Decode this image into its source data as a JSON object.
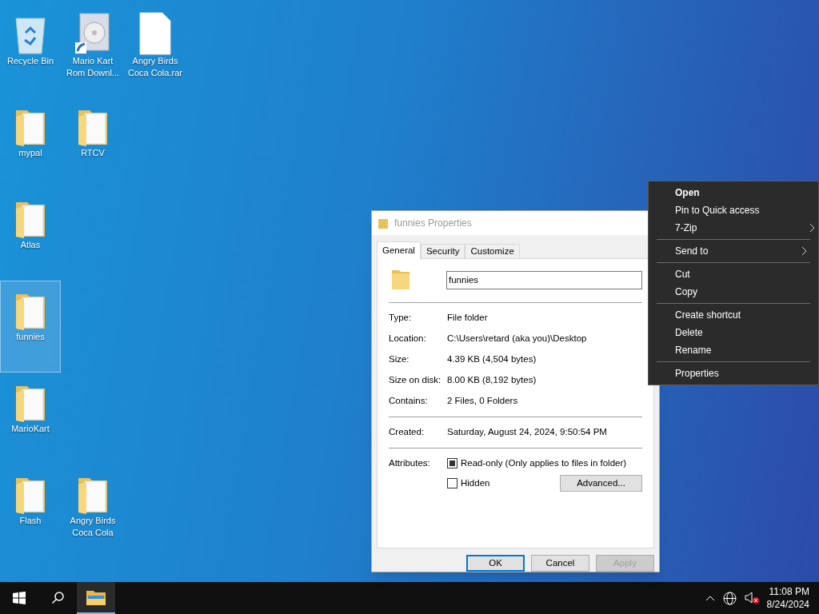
{
  "desktop": {
    "rows": [
      [
        {
          "label": "Recycle Bin",
          "kind": "recycle",
          "selected": false
        },
        {
          "label": "Mario Kart Rom Downl...",
          "kind": "installer",
          "selected": false
        },
        {
          "label": "Angry Birds Coca Cola.rar",
          "kind": "file",
          "selected": false
        }
      ],
      [
        {
          "label": "mypal",
          "kind": "folder",
          "selected": false
        },
        {
          "label": "RTCV",
          "kind": "folder",
          "selected": false
        }
      ],
      [
        {
          "label": "Atlas",
          "kind": "folder",
          "selected": false
        }
      ],
      [
        {
          "label": "funnies",
          "kind": "folder",
          "selected": true
        }
      ],
      [
        {
          "label": "MarioKart",
          "kind": "folder",
          "selected": false
        }
      ],
      [
        {
          "label": "Flash",
          "kind": "folder",
          "selected": false
        },
        {
          "label": "Angry Birds Coca Cola",
          "kind": "folder",
          "selected": false
        }
      ]
    ]
  },
  "dialog": {
    "title": "funnies Properties",
    "tabs": [
      {
        "label": "General",
        "selected": true
      },
      {
        "label": "Security",
        "selected": false
      },
      {
        "label": "Customize",
        "selected": false
      }
    ],
    "name_value": "funnies",
    "groups": [
      [
        {
          "label": "Type:",
          "value": "File folder"
        },
        {
          "label": "Location:",
          "value": "C:\\Users\\retard (aka you)\\Desktop"
        },
        {
          "label": "Size:",
          "value": "4.39 KB (4,504 bytes)"
        },
        {
          "label": "Size on disk:",
          "value": "8.00 KB (8,192 bytes)"
        },
        {
          "label": "Contains:",
          "value": "2 Files, 0 Folders"
        }
      ],
      [
        {
          "label": "Created:",
          "value": "Saturday, August 24, 2024, 9:50:54 PM"
        }
      ]
    ],
    "attributes_label": "Attributes:",
    "attributes": [
      {
        "label": "Read-only (Only applies to files in folder)",
        "checked": true
      },
      {
        "label": "Hidden",
        "checked": false
      }
    ],
    "advanced_button": "Advanced...",
    "buttons": [
      {
        "label": "OK",
        "default": true,
        "disabled": false
      },
      {
        "label": "Cancel",
        "default": false,
        "disabled": false
      },
      {
        "label": "Apply",
        "default": false,
        "disabled": true
      }
    ]
  },
  "context_menu": {
    "groups": [
      [
        {
          "label": "Open",
          "default": true,
          "submenu": false
        },
        {
          "label": "Pin to Quick access",
          "default": false,
          "submenu": false
        },
        {
          "label": "7-Zip",
          "default": false,
          "submenu": true
        }
      ],
      [
        {
          "label": "Send to",
          "default": false,
          "submenu": true
        }
      ],
      [
        {
          "label": "Cut",
          "default": false,
          "submenu": false
        },
        {
          "label": "Copy",
          "default": false,
          "submenu": false
        }
      ],
      [
        {
          "label": "Create shortcut",
          "default": false,
          "submenu": false
        },
        {
          "label": "Delete",
          "default": false,
          "submenu": false
        },
        {
          "label": "Rename",
          "default": false,
          "submenu": false
        }
      ],
      [
        {
          "label": "Properties",
          "default": false,
          "submenu": false
        }
      ]
    ]
  },
  "taskbar": {
    "apps": [
      {
        "kind": "explorer",
        "selected": true
      }
    ],
    "clock": {
      "time": "11:08 PM",
      "date": "8/24/2024"
    }
  }
}
